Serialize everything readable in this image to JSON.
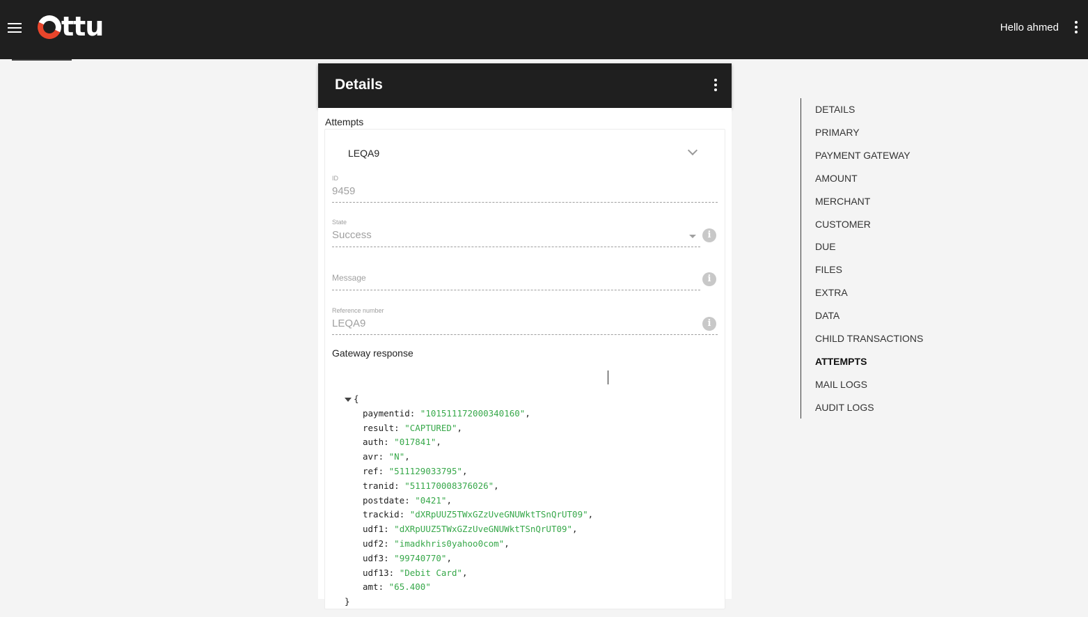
{
  "app": {
    "brand": "Ottu",
    "logo_text": "ttu",
    "greeting": "Hello ahmed",
    "accent_color": "#e9452b"
  },
  "details": {
    "title": "Details"
  },
  "attempts": {
    "section_title": "Attempts",
    "card_label": "LEQA9",
    "fields": {
      "id_label": "ID",
      "id_value": "9459",
      "state_label": "State",
      "state_value": "Success",
      "message_placeholder": "Message",
      "reference_label": "Reference number",
      "reference_value": "LEQA9"
    },
    "gateway_response_title": "Gateway response",
    "gateway_response": {
      "open_brace": "{",
      "close_brace": "}",
      "rows": [
        {
          "key": "paymentid",
          "value": "\"101511172000340160\"",
          "sep": ","
        },
        {
          "key": "result",
          "value": "\"CAPTURED\"",
          "sep": ","
        },
        {
          "key": "auth",
          "value": "\"017841\"",
          "sep": ","
        },
        {
          "key": "avr",
          "value": "\"N\"",
          "sep": ","
        },
        {
          "key": "ref",
          "value": "\"511129033795\"",
          "sep": ","
        },
        {
          "key": "tranid",
          "value": "\"511170008376026\"",
          "sep": ","
        },
        {
          "key": "postdate",
          "value": "\"0421\"",
          "sep": ","
        },
        {
          "key": "trackid",
          "value": "\"dXRpUUZ5TWxGZzUveGNUWktTSnQrUT09\"",
          "sep": ","
        },
        {
          "key": "udf1",
          "value": "\"dXRpUUZ5TWxGZzUveGNUWktTSnQrUT09\"",
          "sep": ","
        },
        {
          "key": "udf2",
          "value": "\"imadkhris0yahoo0com\"",
          "sep": ","
        },
        {
          "key": "udf3",
          "value": "\"99740770\"",
          "sep": ","
        },
        {
          "key": "udf13",
          "value": "\"Debit Card\"",
          "sep": ","
        },
        {
          "key": "amt",
          "value": "\"65.400\"",
          "sep": ""
        }
      ]
    }
  },
  "toc": {
    "active": "ATTEMPTS",
    "items": [
      "DETAILS",
      "PRIMARY",
      "PAYMENT GATEWAY",
      "AMOUNT",
      "MERCHANT",
      "CUSTOMER",
      "DUE",
      "FILES",
      "EXTRA",
      "DATA",
      "CHILD TRANSACTIONS",
      "ATTEMPTS",
      "MAIL LOGS",
      "AUDIT LOGS"
    ]
  },
  "icons": {
    "menu": "hamburger-icon",
    "more": "more-vertical-icon",
    "expand": "chevron-down-icon",
    "info": "info-icon",
    "dropdown": "caret-down-icon"
  }
}
